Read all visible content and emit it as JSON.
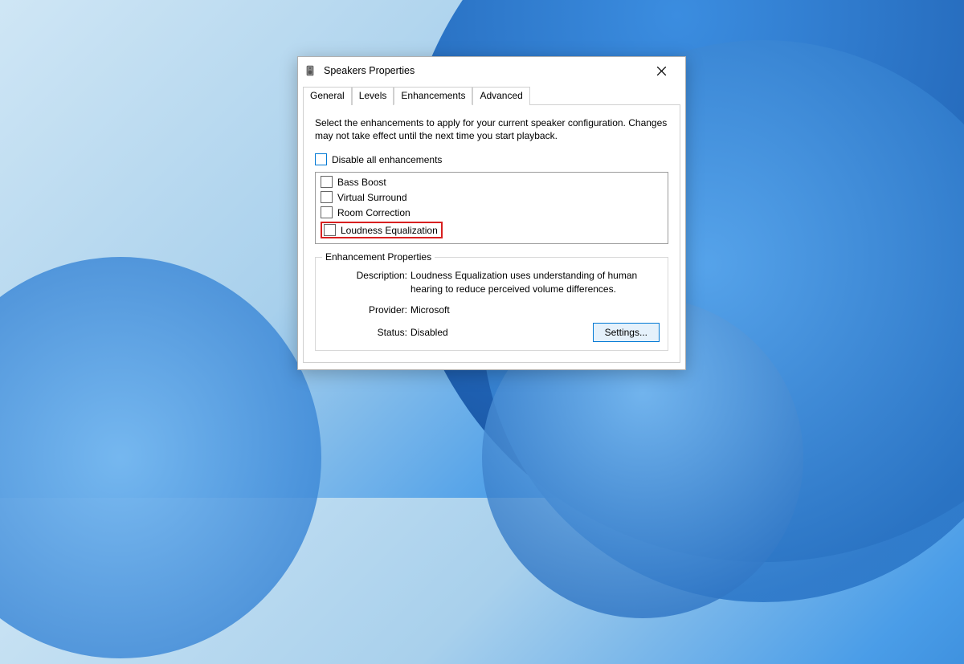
{
  "window": {
    "title": "Speakers Properties"
  },
  "tabs": {
    "general": "General",
    "levels": "Levels",
    "enhancements": "Enhancements",
    "advanced": "Advanced"
  },
  "intro": "Select the enhancements to apply for your current speaker configuration. Changes may not take effect until the next time you start playback.",
  "disable_all": "Disable all enhancements",
  "enhancements": {
    "bass_boost": "Bass Boost",
    "virtual_surround": "Virtual Surround",
    "room_correction": "Room Correction",
    "loudness_eq": "Loudness Equalization"
  },
  "group": {
    "legend": "Enhancement Properties",
    "description_label": "Description:",
    "description_value": "Loudness Equalization uses understanding of human hearing to reduce perceived volume differences.",
    "provider_label": "Provider:",
    "provider_value": "Microsoft",
    "status_label": "Status:",
    "status_value": "Disabled",
    "settings_button": "Settings..."
  }
}
